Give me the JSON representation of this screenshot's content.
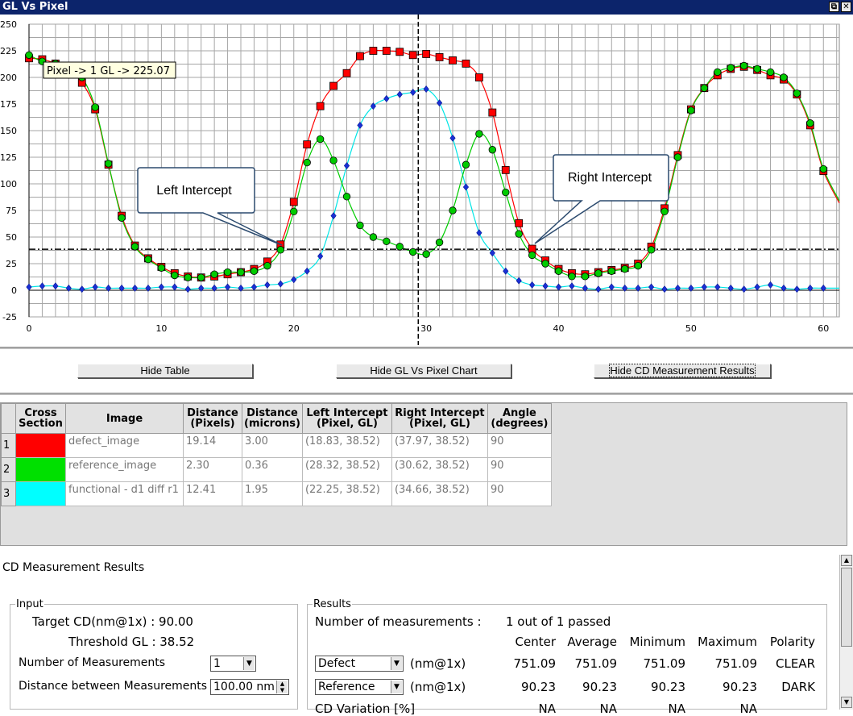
{
  "window": {
    "title": "GL Vs Pixel",
    "restore_glyph": "⧉",
    "close_glyph": "✕"
  },
  "chart": {
    "tooltip": "Pixel -> 1 GL -> 225.07",
    "callout_left": "Left Intercept",
    "callout_right": "Right Intercept",
    "y_ticks": [
      "250",
      "225",
      "200",
      "175",
      "150",
      "125",
      "100",
      "75",
      "50",
      "25",
      "0",
      "-25"
    ],
    "x_ticks": [
      "0",
      "10",
      "20",
      "30",
      "40",
      "50",
      "60"
    ]
  },
  "chart_data": {
    "type": "line",
    "xlabel": "",
    "ylabel": "",
    "xlim": [
      0,
      61.2
    ],
    "ylim": [
      -25,
      250
    ],
    "threshold_gl": 38.52,
    "cursor_x": 29.4,
    "x": [
      0,
      1,
      2,
      3,
      4,
      5,
      6,
      7,
      8,
      9,
      10,
      11,
      12,
      13,
      14,
      15,
      16,
      17,
      18,
      19,
      20,
      21,
      22,
      23,
      24,
      25,
      26,
      27,
      28,
      29,
      30,
      31,
      32,
      33,
      34,
      35,
      36,
      37,
      38,
      39,
      40,
      41,
      42,
      43,
      44,
      45,
      46,
      47,
      48,
      49,
      50,
      51,
      52,
      53,
      54,
      55,
      56,
      57,
      58,
      59,
      60
    ],
    "series": [
      {
        "color": "#ff0000",
        "marker": "square",
        "values": [
          218,
          217,
          213,
          206,
          195,
          170,
          118,
          70,
          42,
          30,
          22,
          16,
          13,
          12,
          13,
          15,
          17,
          20,
          27,
          43,
          83,
          137,
          173,
          192,
          204,
          220,
          225,
          225,
          224,
          221,
          222,
          219,
          216,
          213,
          200,
          167,
          113,
          63,
          39,
          28,
          20,
          16,
          15,
          17,
          19,
          21,
          25,
          41,
          77,
          127,
          170,
          190,
          202,
          208,
          210,
          207,
          202,
          198,
          184,
          155,
          112
        ]
      },
      {
        "color": "#00cc00",
        "marker": "circle",
        "values": [
          221,
          215,
          213,
          208,
          200,
          172,
          119,
          68,
          41,
          29,
          21,
          14,
          12,
          12,
          15,
          17,
          17,
          18,
          23,
          38,
          74,
          120,
          142,
          122,
          88,
          61,
          50,
          46,
          41,
          36,
          34,
          45,
          75,
          118,
          147,
          132,
          92,
          53,
          33,
          25,
          18,
          13,
          13,
          16,
          18,
          20,
          23,
          38,
          74,
          125,
          169,
          190,
          205,
          209,
          211,
          208,
          205,
          200,
          185,
          157,
          114
        ]
      },
      {
        "color": "#00e5e5",
        "marker": "diamond",
        "values": [
          3,
          4,
          4,
          2,
          1,
          3,
          2,
          2,
          2,
          2,
          3,
          3,
          1,
          2,
          2,
          3,
          2,
          3,
          5,
          6,
          10,
          18,
          32,
          70,
          117,
          155,
          173,
          180,
          184,
          186,
          189,
          176,
          143,
          97,
          54,
          35,
          18,
          9,
          5,
          4,
          3,
          4,
          2,
          1,
          3,
          2,
          2,
          3,
          1,
          2,
          2,
          3,
          3,
          2,
          1,
          3,
          5,
          2,
          1,
          2,
          2
        ]
      }
    ]
  },
  "buttons": {
    "hide_table": "Hide Table",
    "hide_chart": "Hide GL Vs Pixel Chart",
    "hide_cd": "Hide CD Measurement Results"
  },
  "table": {
    "headers": [
      {
        "line1": "Cross",
        "line2": "Section"
      },
      {
        "line1": "Image",
        "line2": ""
      },
      {
        "line1": "Distance",
        "line2": "(Pixels)"
      },
      {
        "line1": "Distance",
        "line2": "(microns)"
      },
      {
        "line1": "Left Intercept",
        "line2": "(Pixel, GL)"
      },
      {
        "line1": "Right Intercept",
        "line2": "(Pixel, GL)"
      },
      {
        "line1": "Angle",
        "line2": "(degrees)"
      }
    ],
    "rows": [
      {
        "num": "1",
        "color": "#ff0000",
        "image": "defect_image",
        "dist_px": "19.14",
        "dist_um": "3.00",
        "left": "(18.83, 38.52)",
        "right": "(37.97, 38.52)",
        "angle": "90"
      },
      {
        "num": "2",
        "color": "#00e000",
        "image": "reference_image",
        "dist_px": "2.30",
        "dist_um": "0.36",
        "left": "(28.32, 38.52)",
        "right": "(30.62, 38.52)",
        "angle": "90"
      },
      {
        "num": "3",
        "color": "#00ffff",
        "image": "functional - d1 diff r1",
        "dist_px": "12.41",
        "dist_um": "1.95",
        "left": "(22.25, 38.52)",
        "right": "(34.66, 38.52)",
        "angle": "90"
      }
    ]
  },
  "cd": {
    "title": "CD Measurement Results",
    "input": {
      "legend": "Input",
      "target_label": "Target CD(nm@1x) : 90.00",
      "threshold_label": "Threshold GL : 38.52",
      "num_meas_label": "Number of Measurements",
      "num_meas_value": "1",
      "dist_label": "Distance between Measurements",
      "dist_value": "100.00  nm"
    },
    "results": {
      "legend": "Results",
      "num_label": "Number of measurements :",
      "num_value": "1 out of 1 passed",
      "col_headers": [
        "Center",
        "Average",
        "Minimum",
        "Maximum",
        "Polarity"
      ],
      "rows": [
        {
          "select": "Defect",
          "unit": "(nm@1x)",
          "values": [
            "751.09",
            "751.09",
            "751.09",
            "751.09",
            "CLEAR"
          ]
        },
        {
          "select": "Reference",
          "unit": "(nm@1x)",
          "values": [
            "90.23",
            "90.23",
            "90.23",
            "90.23",
            "DARK"
          ]
        }
      ],
      "cut_row": {
        "label": "CD Variation [%]",
        "values": [
          "NA",
          "NA",
          "NA",
          "NA"
        ]
      }
    }
  }
}
